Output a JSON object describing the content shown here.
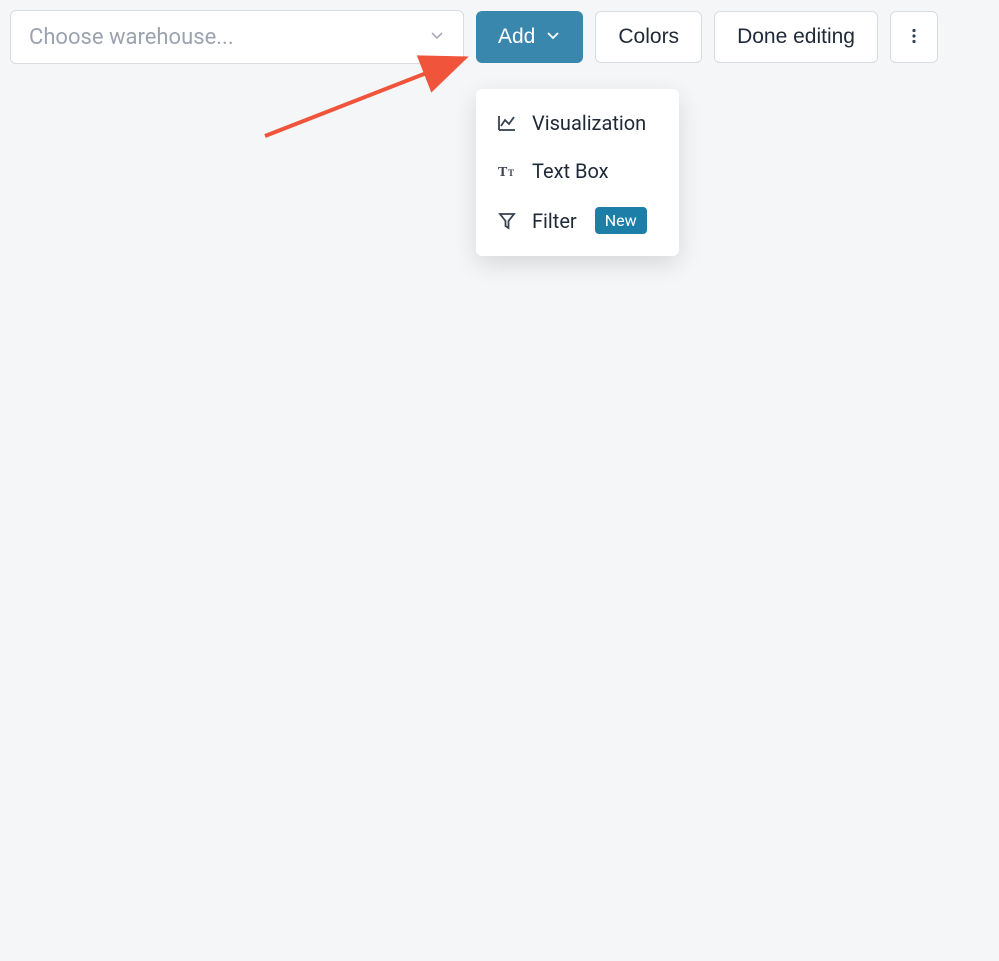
{
  "toolbar": {
    "warehouse_placeholder": "Choose warehouse...",
    "add_label": "Add",
    "colors_label": "Colors",
    "done_label": "Done editing"
  },
  "dropdown": {
    "items": [
      {
        "label": "Visualization",
        "icon": "chart"
      },
      {
        "label": "Text Box",
        "icon": "text"
      },
      {
        "label": "Filter",
        "icon": "filter",
        "badge": "New"
      }
    ]
  }
}
